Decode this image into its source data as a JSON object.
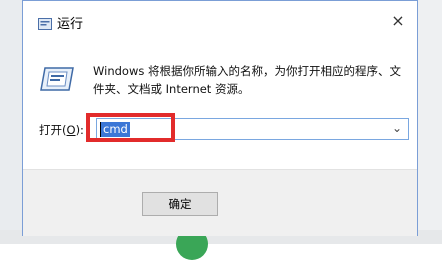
{
  "dialog": {
    "title": "运行",
    "close_glyph": "×",
    "description": "Windows 将根据你所输入的名称，为你打开相应的程序、文件夹、文档或 Internet 资源。",
    "open_label_prefix": "打开(",
    "open_label_hotkey": "O",
    "open_label_suffix": "):",
    "input_value": "cmd",
    "dropdown_glyph": "⌄",
    "ok_label": "确定"
  },
  "colors": {
    "highlight": "#e22b2b",
    "selection": "#3c77d6",
    "dialog_border": "#7b9ed6"
  },
  "icons": {
    "title": "run-app-icon",
    "main": "run-app-icon",
    "close": "close-icon",
    "dropdown": "chevron-down-icon"
  }
}
